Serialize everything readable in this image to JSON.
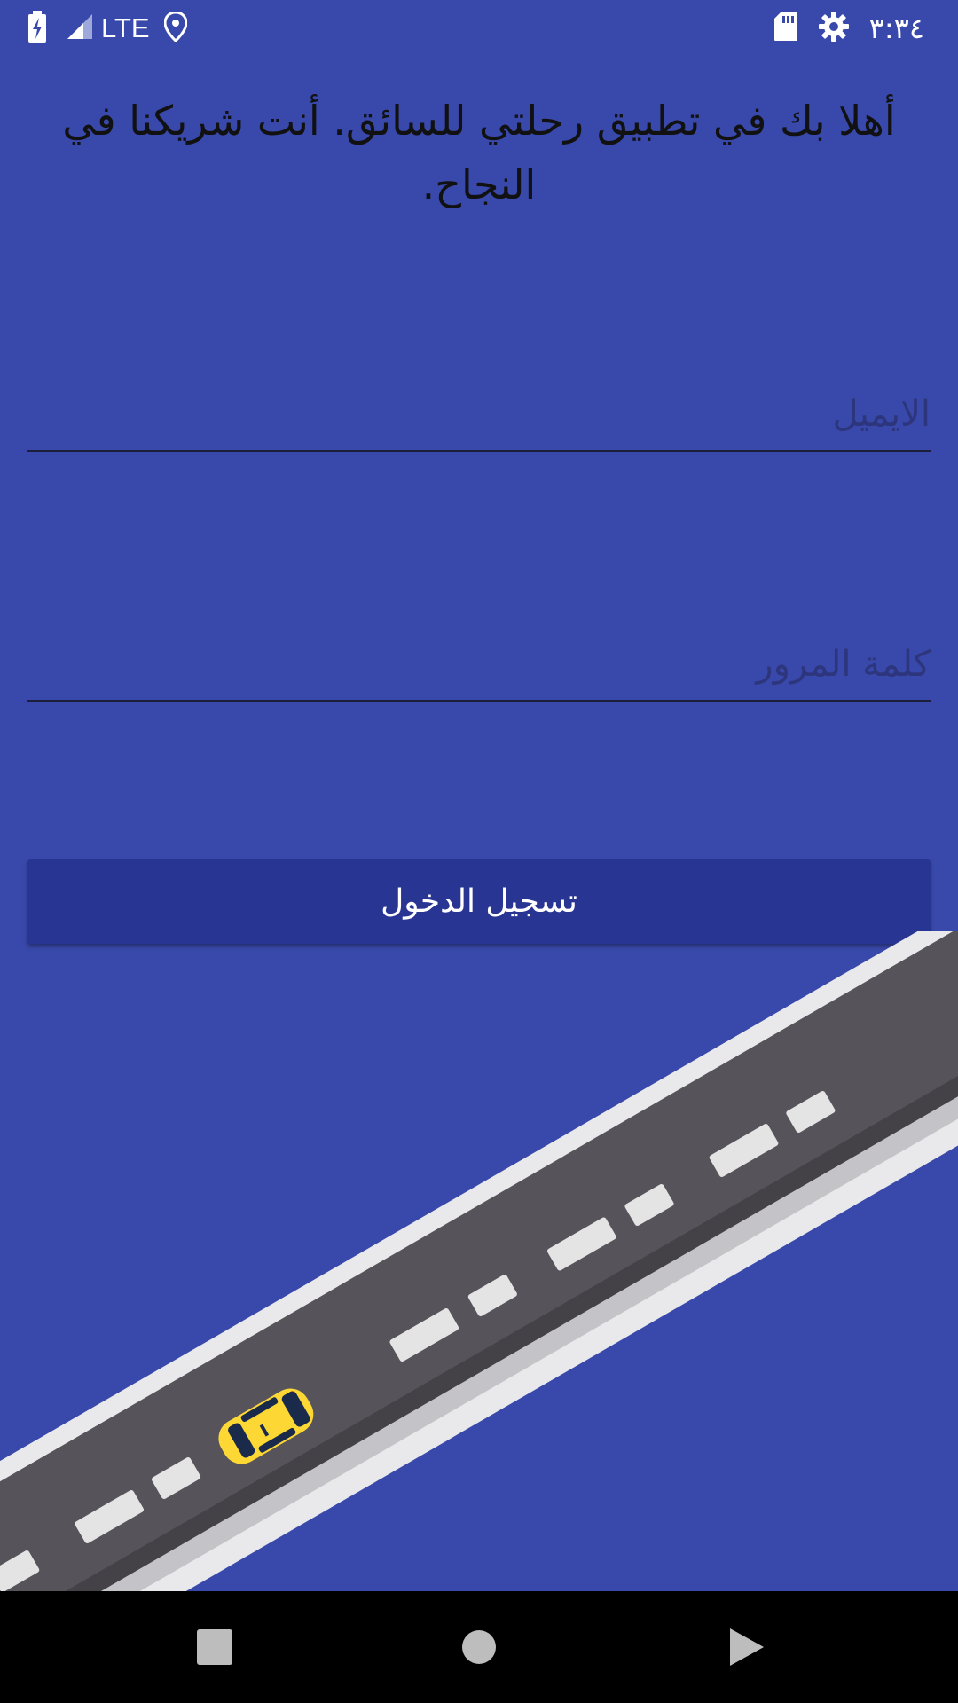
{
  "status_bar": {
    "network": "LTE",
    "clock": "٣:٣٤",
    "icons": [
      "battery-charging-icon",
      "signal-icon",
      "location-icon",
      "sd-card-icon",
      "settings-gear-icon"
    ]
  },
  "welcome_message": "أهلا بك في تطبيق رحلتي للسائق. أنت شريكنا في النجاح.",
  "form": {
    "email_placeholder": "الايميل",
    "email_value": "",
    "password_placeholder": "كلمة المرور",
    "password_value": "",
    "login_label": "تسجيل الدخول"
  },
  "colors": {
    "background": "#3949ab",
    "button": "#283593",
    "car": "#fdd835"
  },
  "nav_bar": {
    "buttons": [
      "recents-square-icon",
      "home-circle-icon",
      "back-triangle-icon"
    ]
  }
}
